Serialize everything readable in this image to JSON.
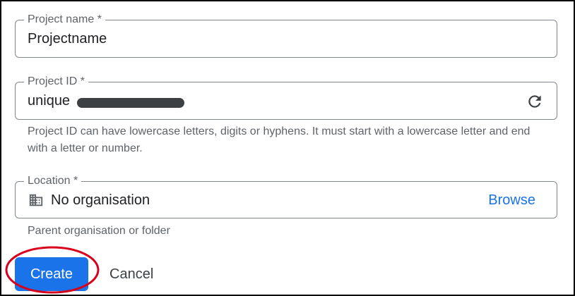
{
  "form": {
    "project_name": {
      "label": "Project name *",
      "value": "Projectname"
    },
    "project_id": {
      "label": "Project ID *",
      "value": "unique",
      "helper": "Project ID can have lowercase letters, digits or hyphens. It must start with a lowercase letter and end with a letter or number.",
      "refresh_icon": "refresh-icon"
    },
    "location": {
      "label": "Location *",
      "value": "No organisation",
      "icon": "building-icon",
      "browse_label": "Browse",
      "helper": "Parent organisation or folder"
    }
  },
  "actions": {
    "create_label": "Create",
    "cancel_label": "Cancel"
  },
  "colors": {
    "primary": "#1a73e8",
    "outline": "#80868b",
    "annotation": "#d9001b"
  }
}
